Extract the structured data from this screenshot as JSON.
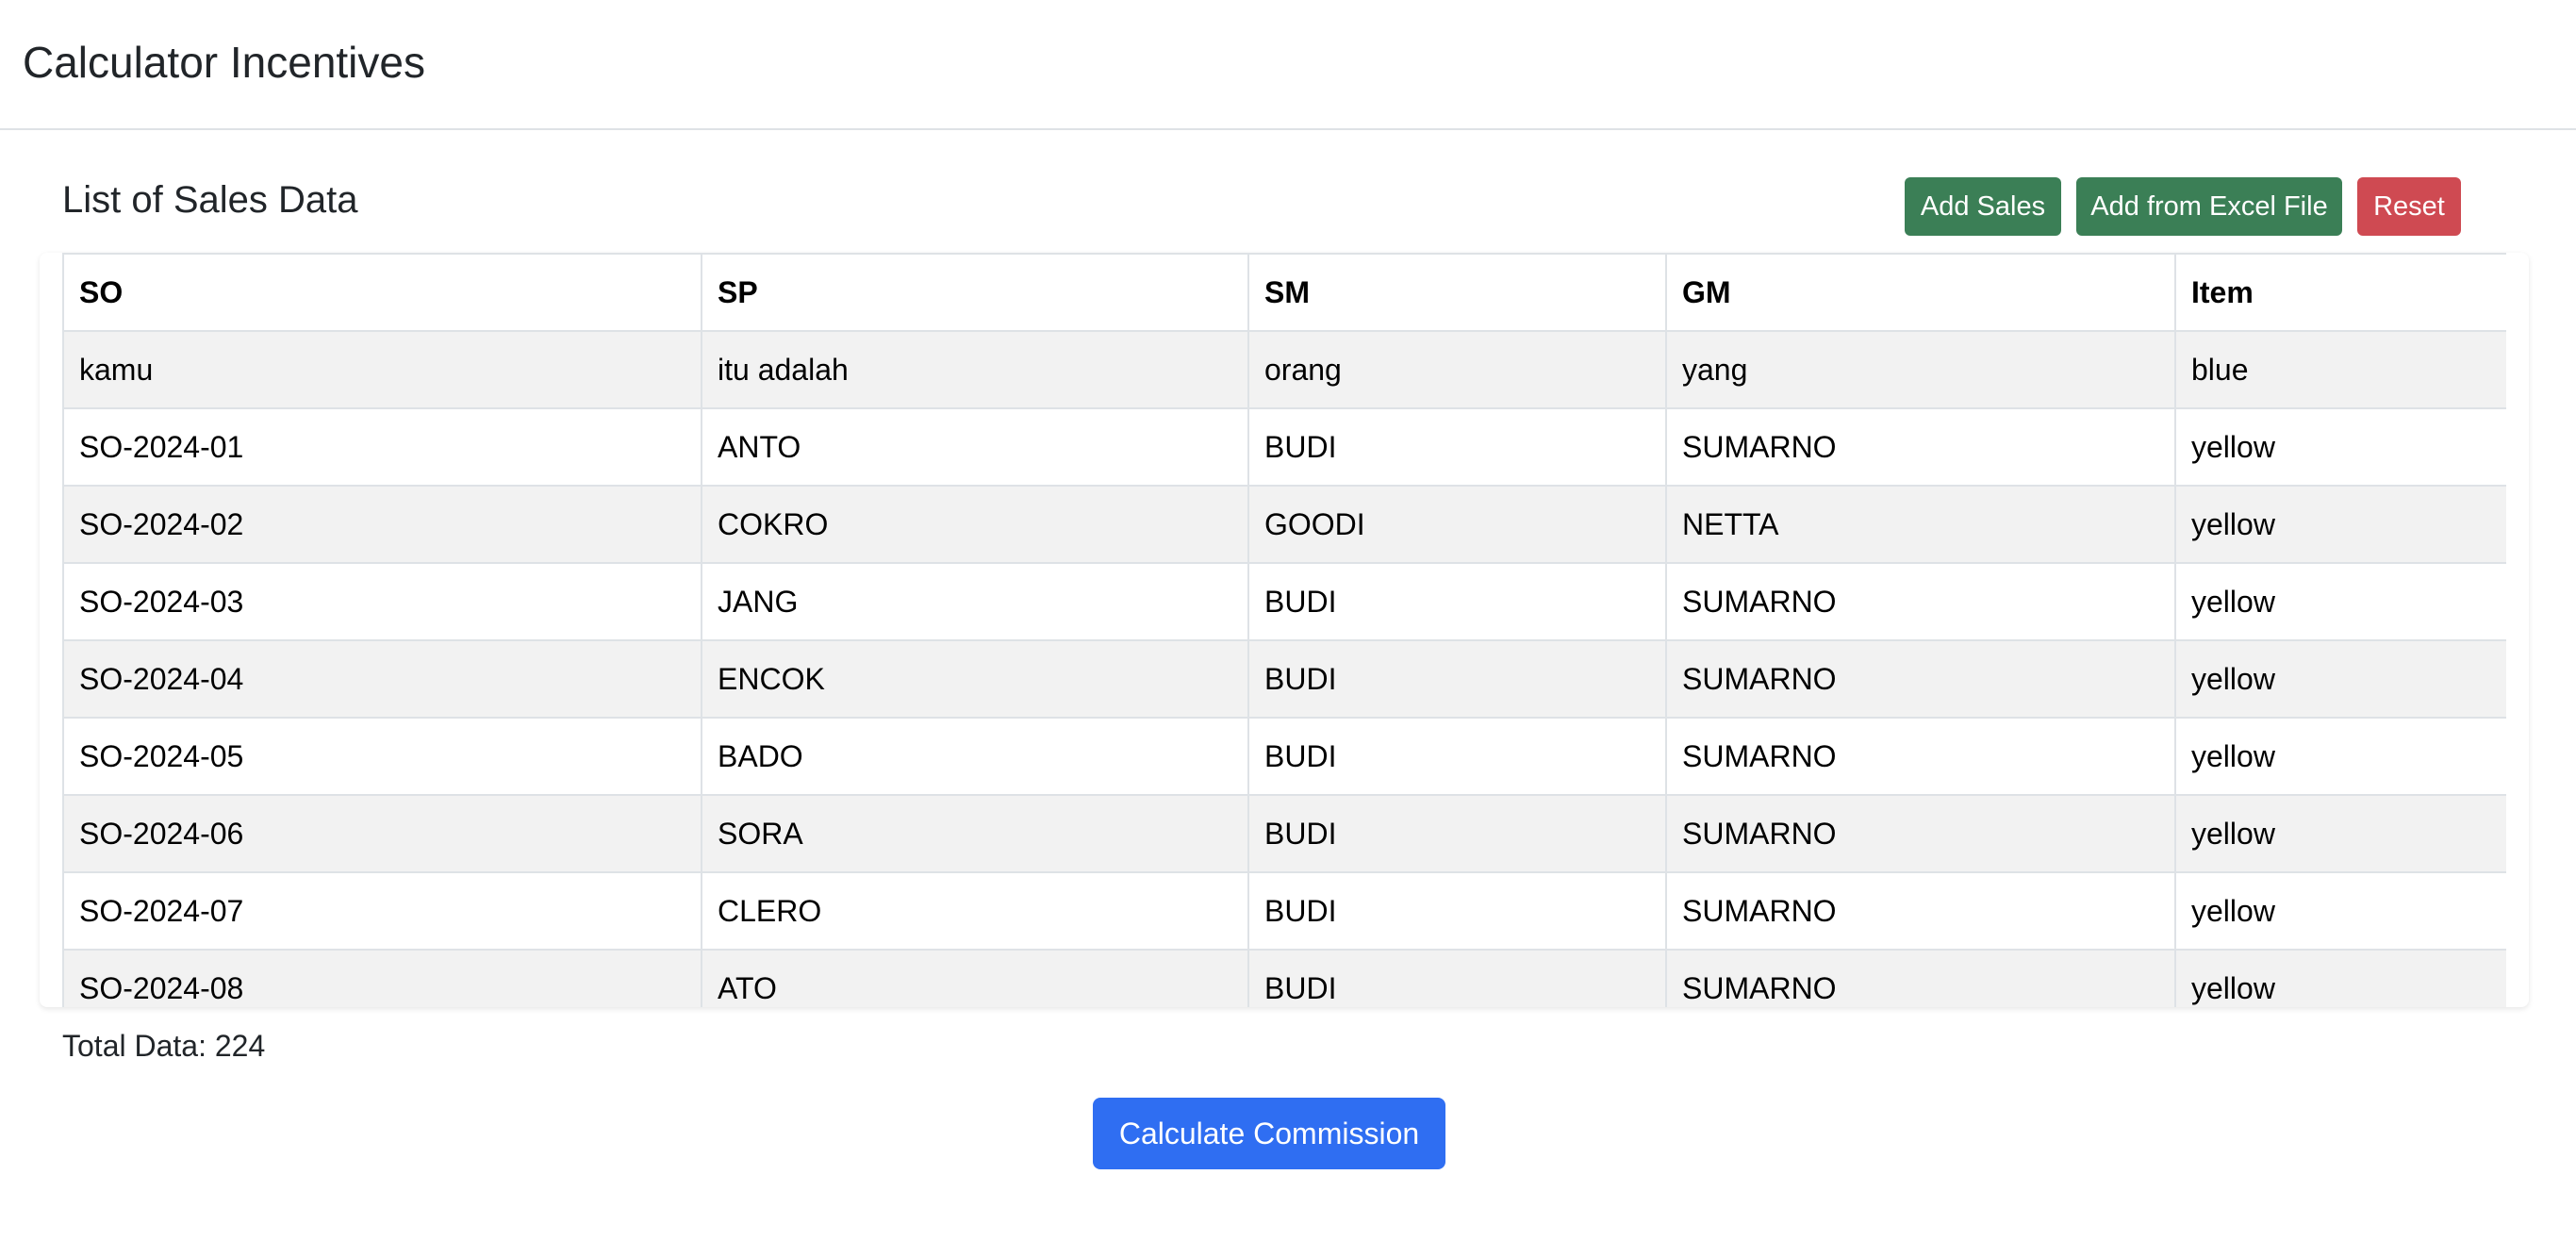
{
  "app": {
    "title": "Calculator Incentives"
  },
  "section": {
    "title": "List of Sales Data"
  },
  "toolbar": {
    "add_sales_label": "Add Sales",
    "add_excel_label": "Add from Excel File",
    "reset_label": "Reset"
  },
  "table": {
    "headers": [
      "SO",
      "SP",
      "SM",
      "GM",
      "Item"
    ],
    "rows": [
      [
        "kamu",
        "itu adalah",
        "orang",
        "yang",
        "blue"
      ],
      [
        "SO-2024-01",
        "ANTO",
        "BUDI",
        "SUMARNO",
        "yellow"
      ],
      [
        "SO-2024-02",
        "COKRO",
        "GOODI",
        "NETTA",
        "yellow"
      ],
      [
        "SO-2024-03",
        "JANG",
        "BUDI",
        "SUMARNO",
        "yellow"
      ],
      [
        "SO-2024-04",
        "ENCOK",
        "BUDI",
        "SUMARNO",
        "yellow"
      ],
      [
        "SO-2024-05",
        "BADO",
        "BUDI",
        "SUMARNO",
        "yellow"
      ],
      [
        "SO-2024-06",
        "SORA",
        "BUDI",
        "SUMARNO",
        "yellow"
      ],
      [
        "SO-2024-07",
        "CLERO",
        "BUDI",
        "SUMARNO",
        "yellow"
      ],
      [
        "SO-2024-08",
        "ATO",
        "BUDI",
        "SUMARNO",
        "yellow"
      ]
    ]
  },
  "footer": {
    "total_data": "Total Data: 224",
    "calculate_label": "Calculate Commission"
  },
  "colors": {
    "success": "#3b7f56",
    "danger": "#cf4a52",
    "primary": "#2f6ef2"
  }
}
